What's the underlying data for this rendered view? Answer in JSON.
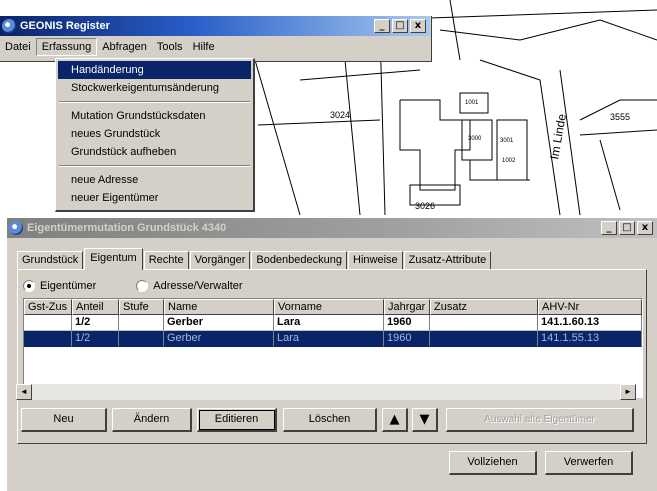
{
  "map": {
    "labels": [
      "3024",
      "3026",
      "3555",
      "1001",
      "3000",
      "3001",
      "1002",
      "Im Linde"
    ]
  },
  "geonis_window": {
    "title": "GEONIS Register",
    "controls": [
      "_",
      "□",
      "x"
    ],
    "menu": [
      {
        "label": "Datei",
        "active": false
      },
      {
        "label": "Erfassung",
        "active": true
      },
      {
        "label": "Abfragen",
        "active": false
      },
      {
        "label": "Tools",
        "active": false
      },
      {
        "label": "Hilfe",
        "active": false
      }
    ],
    "dropdown": {
      "groups": [
        [
          "Handänderung",
          "Stockwerkeigentumsänderung"
        ],
        [
          "Mutation Grundstücksdaten",
          "neues Grundstück",
          "Grundstück aufheben"
        ],
        [
          "neue Adresse",
          "neuer Eigentümer"
        ]
      ],
      "selected": "Handänderung"
    }
  },
  "eig_window": {
    "title": "Eigentümermutation Grundstück 4340",
    "controls": [
      "_",
      "□",
      "x"
    ],
    "tabs": [
      {
        "label": "Grundstück",
        "active": false
      },
      {
        "label": "Eigentum",
        "active": true
      },
      {
        "label": "Rechte",
        "active": false
      },
      {
        "label": "Vorgänger",
        "active": false
      },
      {
        "label": "Bodenbedeckung",
        "active": false
      },
      {
        "label": "Hinweise",
        "active": false
      },
      {
        "label": "Zusatz-Attribute",
        "active": false
      }
    ],
    "radios": [
      {
        "label": "Eigentümer",
        "checked": true
      },
      {
        "label": "Adresse/Verwalter",
        "checked": false
      }
    ],
    "table": {
      "columns": [
        "Gst-Zus",
        "Anteil",
        "Stufe",
        "Name",
        "Vorname",
        "Jahrgar",
        "Zusatz",
        "AHV-Nr"
      ],
      "rows": [
        {
          "cells": [
            "",
            "1/2",
            "",
            "Gerber",
            "Lara",
            "1960",
            "",
            "141.1.60.13"
          ],
          "selected": false
        },
        {
          "cells": [
            "",
            "1/2",
            "",
            "Gerber",
            "Lara",
            "1960",
            "",
            "141.1.55.13"
          ],
          "selected": true
        }
      ]
    },
    "scroll": {
      "left": "◄",
      "right": "►"
    },
    "buttons": {
      "neu": "Neu",
      "aendern": "Ändern",
      "editieren": "Editieren",
      "loeschen": "Löschen",
      "up": "▲",
      "down": "▼",
      "auswahl": "Auswahl alte Eigentümer",
      "vollziehen": "Vollziehen",
      "verwerfen": "Verwerfen"
    }
  }
}
